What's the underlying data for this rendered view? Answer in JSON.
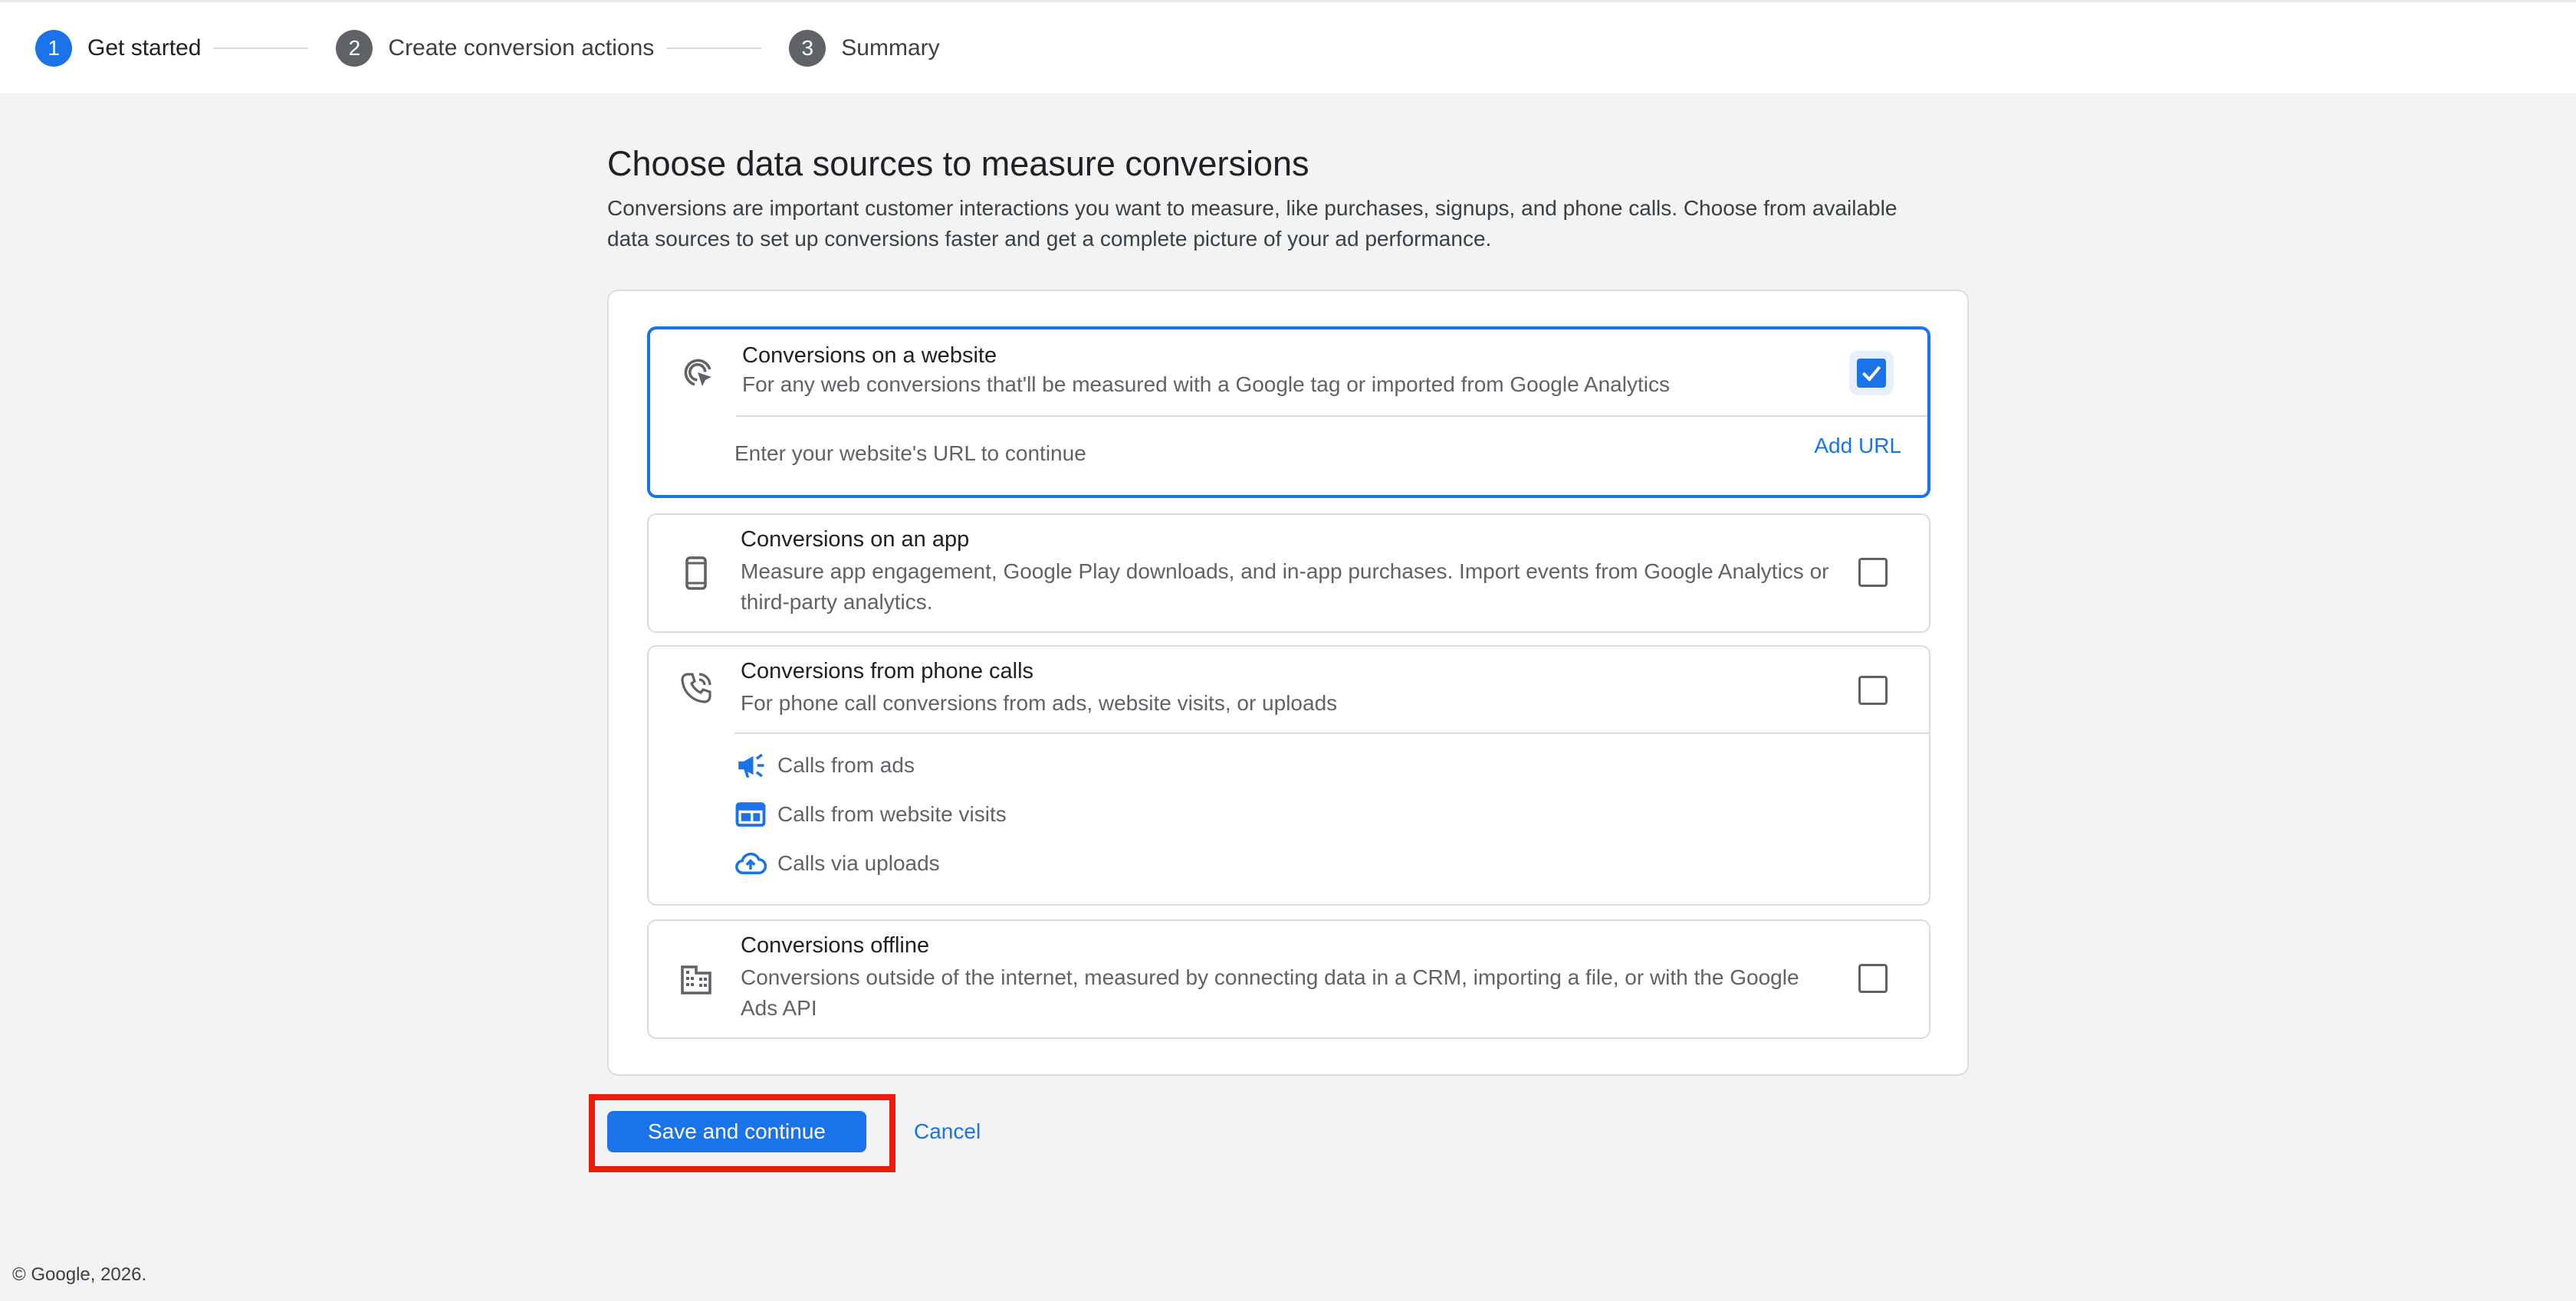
{
  "stepper": {
    "steps": [
      {
        "num": "1",
        "label": "Get started"
      },
      {
        "num": "2",
        "label": "Create conversion actions"
      },
      {
        "num": "3",
        "label": "Summary"
      }
    ]
  },
  "main": {
    "title": "Choose data sources to measure conversions",
    "description": "Conversions are important customer interactions you want to measure, like purchases, signups, and phone calls. Choose from available data sources to set up conversions faster and get a complete picture of your ad performance."
  },
  "options": {
    "website": {
      "title": "Conversions on a website",
      "desc": "For any web conversions that'll be measured with a Google tag or imported from Google Analytics",
      "url_hint": "Enter your website's URL to continue",
      "add_url": "Add URL",
      "checked": true
    },
    "app": {
      "title": "Conversions on an app",
      "desc": "Measure app engagement, Google Play downloads, and in-app purchases. Import events from Google Analytics or third-party analytics.",
      "checked": false
    },
    "phone": {
      "title": "Conversions from phone calls",
      "desc": "For phone call conversions from ads, website visits, or uploads",
      "checked": false,
      "sub_items": [
        {
          "label": "Calls from ads",
          "icon": "megaphone-icon"
        },
        {
          "label": "Calls from website visits",
          "icon": "web-page-icon"
        },
        {
          "label": "Calls via uploads",
          "icon": "cloud-upload-icon"
        }
      ]
    },
    "offline": {
      "title": "Conversions offline",
      "desc": "Conversions outside of the internet, measured by connecting data in a CRM, importing a file, or with the Google Ads API",
      "checked": false
    }
  },
  "actions": {
    "save": "Save and continue",
    "cancel": "Cancel"
  },
  "footer": {
    "copyright": "© Google, 2026."
  },
  "colors": {
    "accent": "#1a73e8",
    "highlight": "#ea1c0d"
  }
}
